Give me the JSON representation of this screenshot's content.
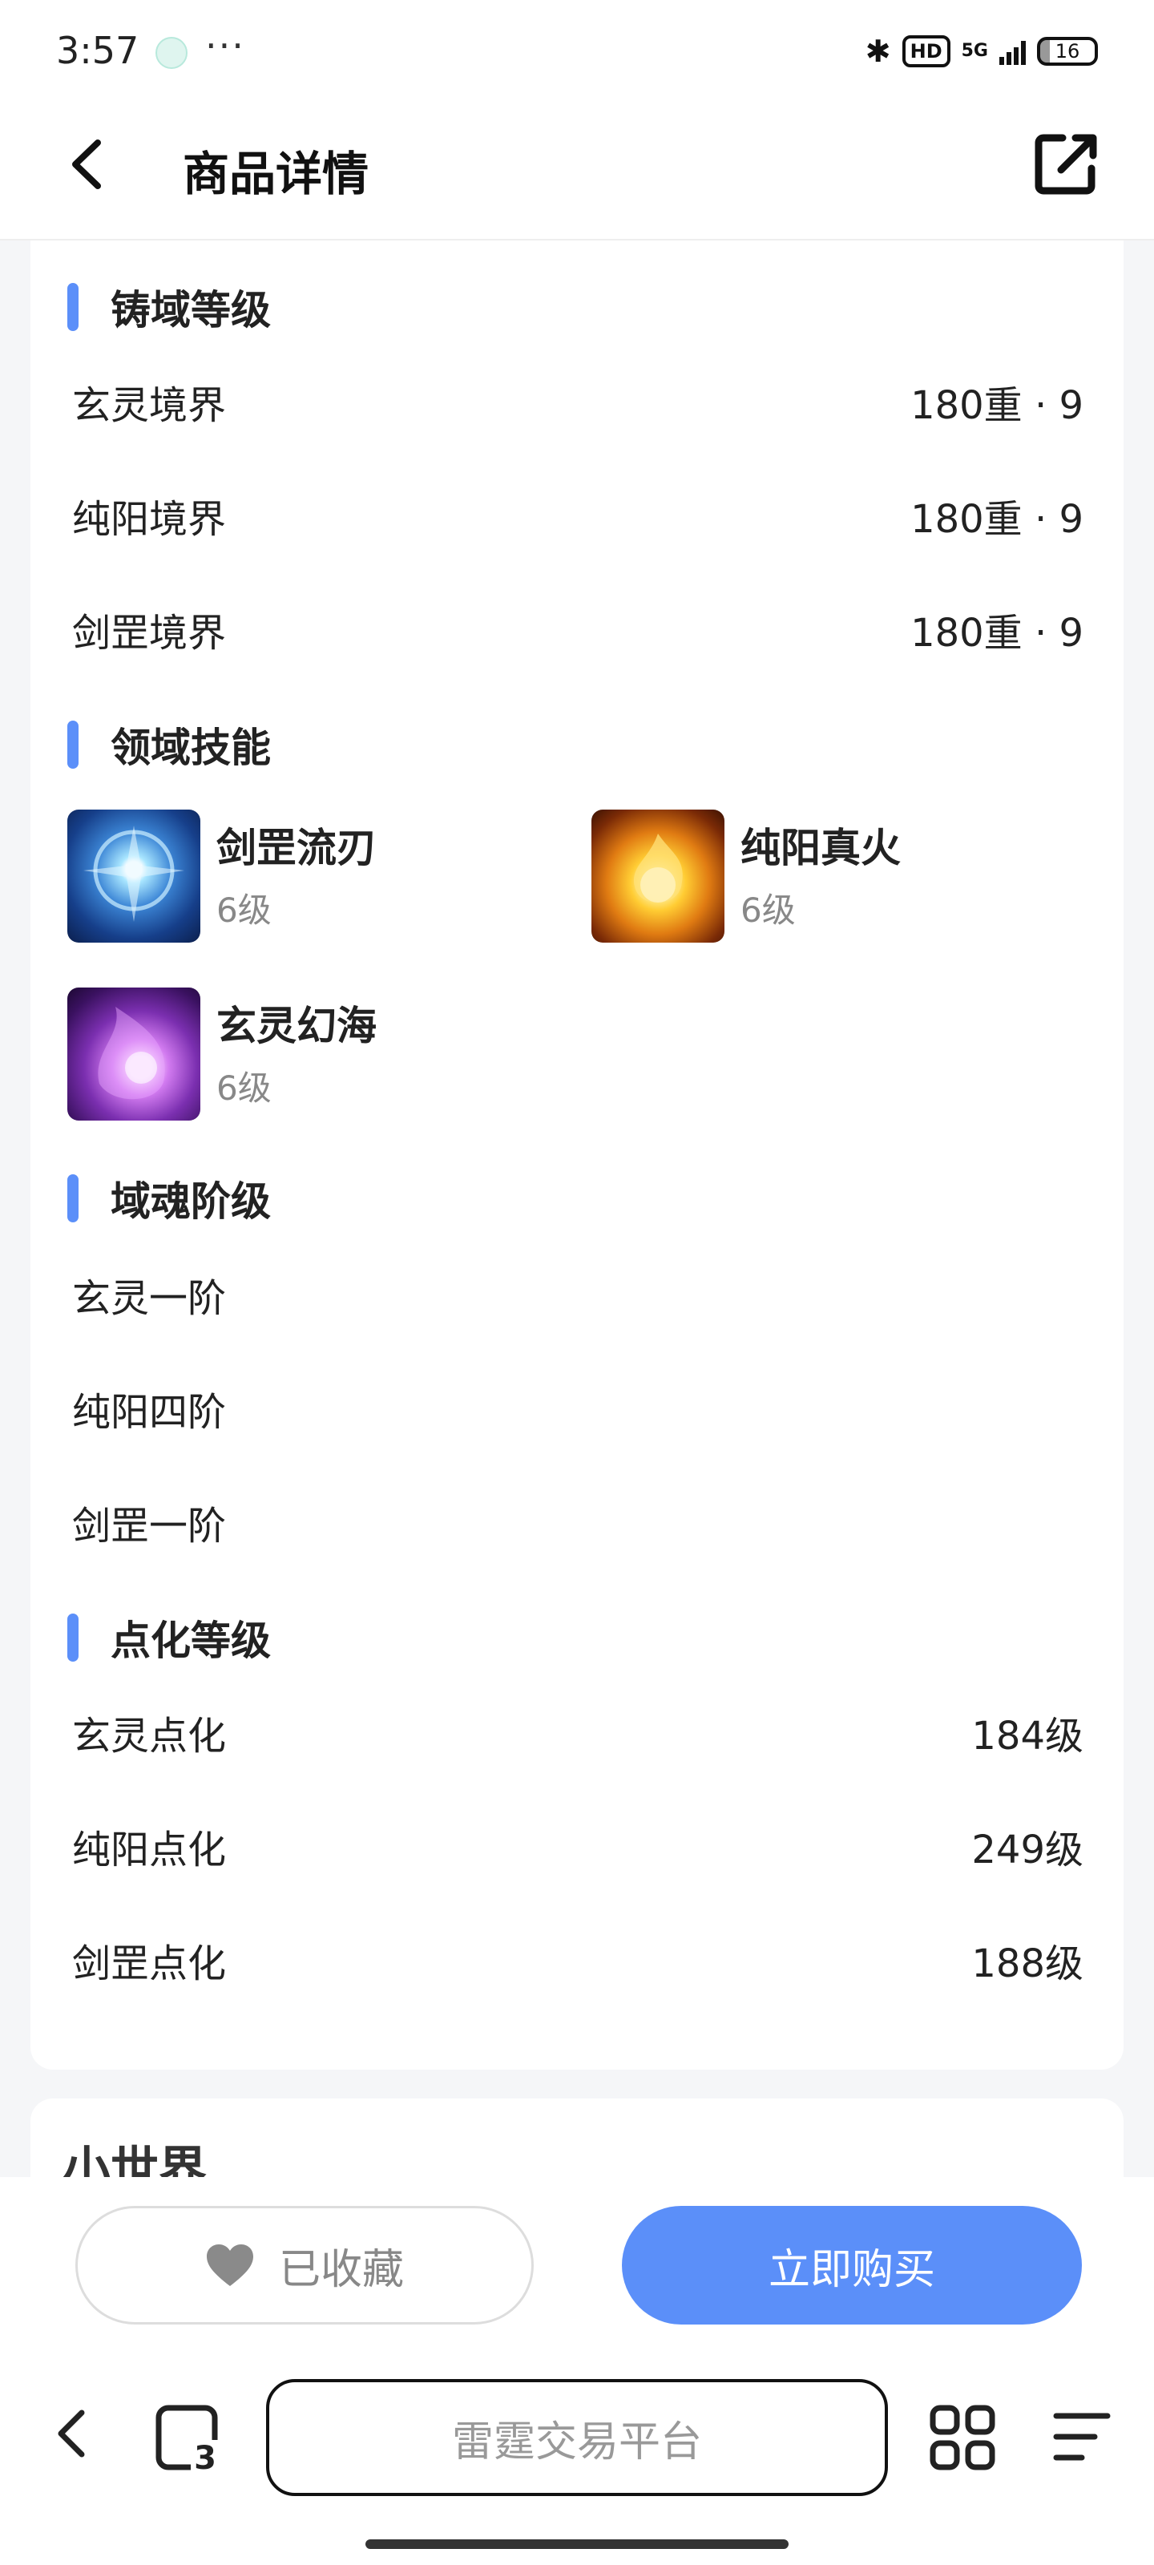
{
  "status_bar": {
    "time": "3:57",
    "more": "···",
    "hd": "HD",
    "network": "5G",
    "battery": "16"
  },
  "header": {
    "title": "商品详情",
    "back_icon": "chevron-left-icon",
    "share_icon": "share-external-icon"
  },
  "sections": {
    "forge_level": {
      "title": "铸域等级",
      "rows": [
        {
          "label": "玄灵境界",
          "value": "180重 · 9"
        },
        {
          "label": "纯阳境界",
          "value": "180重 · 9"
        },
        {
          "label": "剑罡境界",
          "value": "180重 · 9"
        }
      ]
    },
    "domain_skills": {
      "title": "领域技能",
      "skills": [
        {
          "name": "剑罡流刃",
          "level": "6级",
          "icon": "blue-vortex-skill-icon"
        },
        {
          "name": "纯阳真火",
          "level": "6级",
          "icon": "golden-flame-skill-icon"
        },
        {
          "name": "玄灵幻海",
          "level": "6级",
          "icon": "purple-flame-skill-icon"
        }
      ]
    },
    "soul_rank": {
      "title": "域魂阶级",
      "rows": [
        {
          "label": "玄灵一阶"
        },
        {
          "label": "纯阳四阶"
        },
        {
          "label": "剑罡一阶"
        }
      ]
    },
    "enlighten_level": {
      "title": "点化等级",
      "rows": [
        {
          "label": "玄灵点化",
          "value": "184级"
        },
        {
          "label": "纯阳点化",
          "value": "249级"
        },
        {
          "label": "剑罡点化",
          "value": "188级"
        }
      ]
    }
  },
  "next_card": {
    "title": "小世界"
  },
  "actions": {
    "favorite_label": "已收藏",
    "buy_label": "立即购买"
  },
  "browser": {
    "address": "雷霆交易平台",
    "tab_count": "3"
  },
  "colors": {
    "accent": "#5b8ff9",
    "background": "#f5f6f8"
  }
}
